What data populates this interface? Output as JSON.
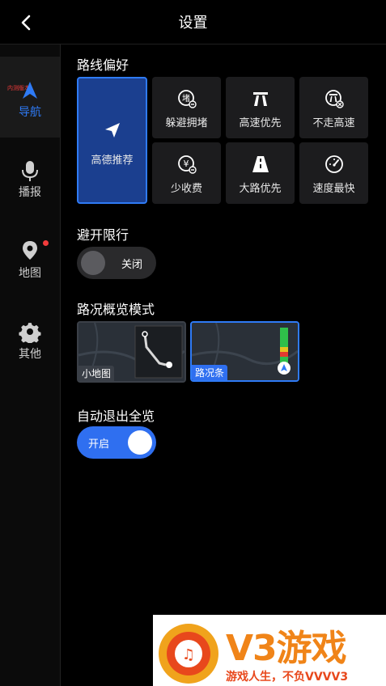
{
  "header": {
    "title": "设置"
  },
  "sidebar": {
    "badge_text": "内测版本",
    "items": [
      {
        "label": "导航",
        "icon": "navigation-arrow-icon",
        "active": true
      },
      {
        "label": "播报",
        "icon": "microphone-icon"
      },
      {
        "label": "地图",
        "icon": "map-pin-icon",
        "has_dot": true
      },
      {
        "label": "其他",
        "icon": "gear-icon"
      }
    ]
  },
  "route_pref": {
    "title": "路线偏好",
    "options": [
      {
        "label": "高德推荐",
        "icon": "send-plane-icon",
        "selected": true
      },
      {
        "label": "躲避拥堵",
        "icon": "avoid-jam-icon"
      },
      {
        "label": "高速优先",
        "icon": "highway-icon"
      },
      {
        "label": "不走高速",
        "icon": "no-highway-icon"
      },
      {
        "label": "少收费",
        "icon": "less-toll-icon"
      },
      {
        "label": "大路优先",
        "icon": "main-road-icon"
      },
      {
        "label": "速度最快",
        "icon": "speedometer-icon"
      }
    ]
  },
  "avoid_limit": {
    "title": "避开限行",
    "state_label": "关闭",
    "on": false
  },
  "traffic_mode": {
    "title": "路况概览模式",
    "options": [
      {
        "label": "小地图",
        "selected": false
      },
      {
        "label": "路况条",
        "selected": true
      }
    ]
  },
  "auto_exit": {
    "title": "自动退出全览",
    "state_label": "开启",
    "on": true
  },
  "ad": {
    "brand": "V3游戏",
    "slogan": "游戏人生，不负VVVV3"
  },
  "colors": {
    "accent": "#2f7bf6",
    "selected_tile": "#1b3f8f",
    "ad_orange": "#f08418"
  }
}
